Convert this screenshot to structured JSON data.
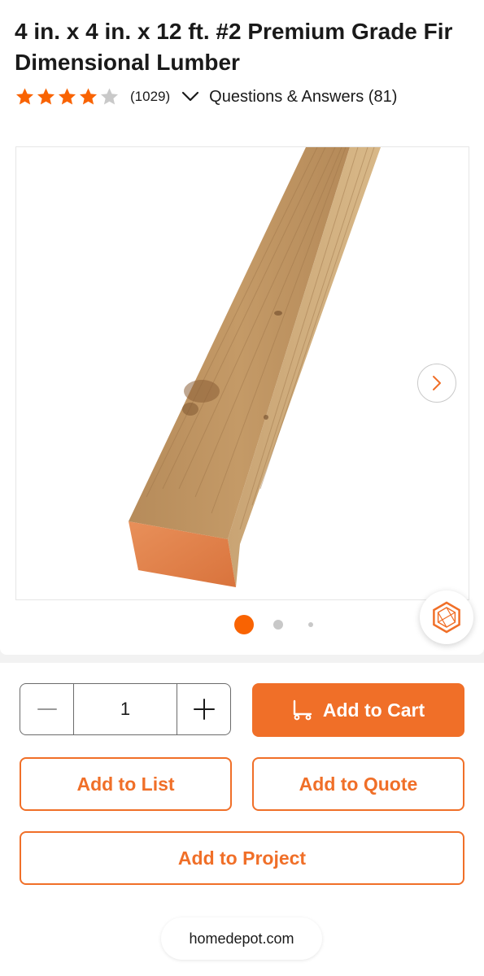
{
  "product": {
    "title": "4 in. x 4 in. x 12 ft. #2 Premium Grade Fir Dimensional Lumber",
    "rating": 4,
    "rating_max": 5,
    "review_count": "(1029)",
    "qa_label": "Questions & Answers (81)"
  },
  "gallery": {
    "image_count_dots": 3,
    "active_index": 0,
    "next_icon": "chevron-right-icon",
    "brand_icon": "home-depot-hexagon-icon"
  },
  "purchase": {
    "quantity": "1",
    "decrement_icon": "minus-icon",
    "increment_icon": "plus-icon",
    "add_to_cart_label": "Add to Cart",
    "cart_icon": "cart-dolly-icon",
    "add_to_list_label": "Add to List",
    "add_to_quote_label": "Add to Quote",
    "add_to_project_label": "Add to Project"
  },
  "browser": {
    "url": "homedepot.com"
  },
  "colors": {
    "accent": "#f06f28",
    "star_filled": "#f96302",
    "star_empty": "#c9c9c9",
    "text": "#1a1a1a"
  }
}
